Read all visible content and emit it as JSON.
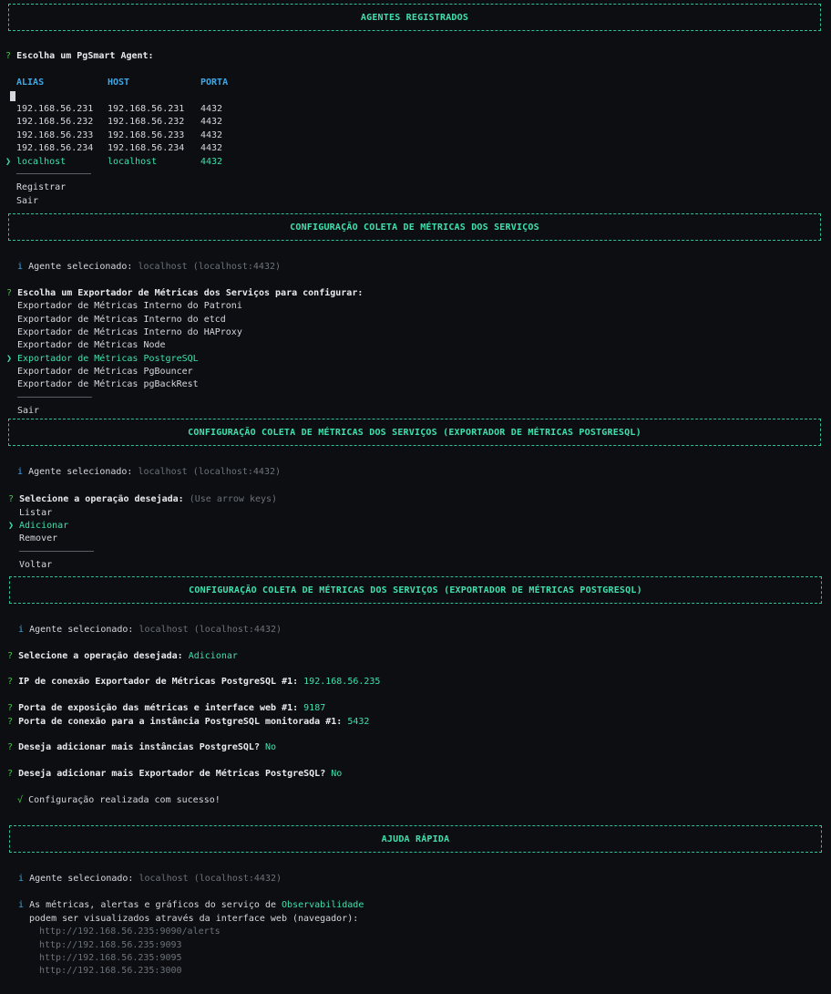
{
  "sections": {
    "agents_title": "AGENTES REGISTRADOS",
    "config_title": "CONFIGURAÇÃO COLETA DE MÉTRICAS DOS SERVIÇOS",
    "config_pg_title": "CONFIGURAÇÃO COLETA DE MÉTRICAS DOS SERVIÇOS (EXPORTADOR DE MÉTRICAS POSTGRESQL)",
    "help_title": "AJUDA RÁPIDA"
  },
  "symbols": {
    "question": "?",
    "info": "i",
    "pointer": "❯",
    "check": "√"
  },
  "agents": {
    "prompt": "Escolha um PgSmart Agent:",
    "headers": [
      "ALIAS",
      "HOST",
      "PORTA"
    ],
    "rows": [
      [
        "192.168.56.231",
        "192.168.56.231",
        "4432"
      ],
      [
        "192.168.56.232",
        "192.168.56.232",
        "4432"
      ],
      [
        "192.168.56.233",
        "192.168.56.233",
        "4432"
      ],
      [
        "192.168.56.234",
        "192.168.56.234",
        "4432"
      ],
      [
        "localhost",
        "localhost",
        "4432"
      ]
    ],
    "selected_index": 4,
    "extra": [
      "Registrar",
      "Sair"
    ]
  },
  "selected_agent": {
    "label": "Agente selecionado:",
    "value": "localhost (localhost:4432)"
  },
  "exporters": {
    "prompt": "Escolha um Exportador de Métricas dos Serviços para configurar:",
    "items": [
      "Exportador de Métricas Interno do Patroni",
      "Exportador de Métricas Interno do etcd",
      "Exportador de Métricas Interno do HAProxy",
      "Exportador de Métricas Node",
      "Exportador de Métricas PostgreSQL",
      "Exportador de Métricas PgBouncer",
      "Exportador de Métricas pgBackRest"
    ],
    "selected_index": 4,
    "exit": "Sair"
  },
  "operation": {
    "prompt": "Selecione a operação desejada:",
    "hint": "(Use arrow keys)",
    "items": [
      "Listar",
      "Adicionar",
      "Remover"
    ],
    "selected_index": 1,
    "back": "Voltar"
  },
  "answers": {
    "op_prompt": "Selecione a operação desejada:",
    "op_value": "Adicionar",
    "ip_prompt": "IP de conexão Exportador de Métricas PostgreSQL",
    "ip_tag": "#1:",
    "ip_value": "192.168.56.235",
    "port_web_prompt": "Porta de exposição das métricas e interface web",
    "port_web_tag": "#1:",
    "port_web_value": "9187",
    "port_pg_prompt": "Porta de conexão para a instância PostgreSQL monitorada",
    "port_pg_tag": "#1:",
    "port_pg_value": "5432",
    "more_inst_prompt": "Deseja adicionar mais instâncias PostgreSQL?",
    "more_inst_value": "No",
    "more_exp_prompt": "Deseja adicionar mais Exportador de Métricas PostgreSQL?",
    "more_exp_value": "No",
    "success": "Configuração realizada com sucesso!"
  },
  "help": {
    "line1_prefix": "As métricas, alertas e gráficos do serviço de",
    "line1_highlight": "Observabilidade",
    "line2": "podem ser visualizados através da interface web (navegador):",
    "urls": [
      "http://192.168.56.235:9090/alerts",
      "http://192.168.56.235:9093",
      "http://192.168.56.235:9095",
      "http://192.168.56.235:3000"
    ]
  },
  "colors": {
    "background": "#0c0e11",
    "accent": "#3fe0ad",
    "question": "#47c74b",
    "header": "#3fa8e8",
    "muted": "#6d737a"
  }
}
